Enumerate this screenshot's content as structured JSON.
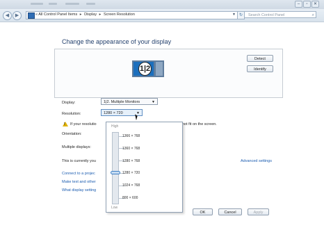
{
  "window": {
    "minimize": "–",
    "restore": "▫",
    "close": "✕"
  },
  "nav": {
    "back": "◀",
    "forward": "▶",
    "address_marker": "«",
    "breadcrumbs": [
      "All Control Panel Items",
      "Display",
      "Screen Resolution"
    ],
    "breadcrumb_sep": "▸",
    "dropdown_arrow": "▼",
    "refresh": "↻",
    "search_placeholder": "Search Control Panel",
    "search_icon": "⌕"
  },
  "main": {
    "title": "Change the appearance of your display",
    "detect_label": "Detect",
    "identify_label": "Identify",
    "monitor_badge": "1|2",
    "display_label": "Display:",
    "display_value": "1|2. Multiple Monitors",
    "resolution_label": "Resolution:",
    "resolution_value": "1280 × 720",
    "warning_text_start": "If your resolutio",
    "warning_text_end": "not fit on the screen.",
    "orientation_label": "Orientation:",
    "multiple_displays_label": "Multiple displays:",
    "current_text": "This is currently you",
    "advanced_link": "Advanced settings",
    "link_projector": "Connect to a projec",
    "link_text_size": "Make text and other",
    "link_display_settings": "What display setting",
    "ok_label": "OK",
    "cancel_label": "Cancel",
    "apply_label": "Apply"
  },
  "resolution_dropdown": {
    "high_label": "High",
    "low_label": "Low",
    "options": [
      "1366 × 768",
      "1360 × 768",
      "1280 × 768",
      "1280 × 720",
      "1024 × 768",
      "800 × 600"
    ],
    "selected": "1280 × 720"
  },
  "colors": {
    "heading": "#25426e",
    "link": "#1b5cb0",
    "monitor": "#1c6fbd",
    "warning": "#e0b200"
  },
  "icons": [
    "back-icon",
    "forward-icon",
    "control-panel-icon",
    "refresh-icon",
    "search-icon",
    "monitor-icon",
    "warning-icon",
    "dropdown-arrow-icon"
  ]
}
